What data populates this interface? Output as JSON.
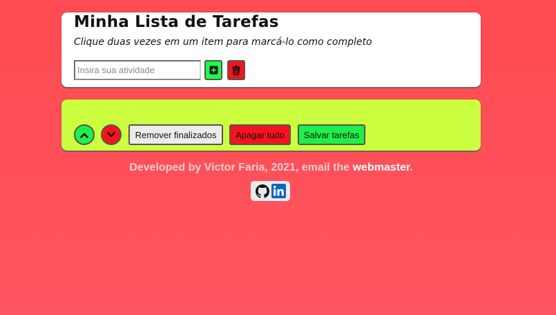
{
  "header": {
    "title": "Minha Lista de Tarefas",
    "subtitle": "Clique duas vezes em um item para marcá-lo como completo"
  },
  "input": {
    "placeholder": "Insira sua atividade",
    "value": ""
  },
  "controls": {
    "add_icon": "plus-square-icon",
    "delete_icon": "trash-icon",
    "move_up_icon": "chevron-up-icon",
    "move_down_icon": "chevron-down-icon",
    "remove_finished_label": "Remover finalizados",
    "clear_all_label": "Apagar tudo",
    "save_label": "Salvar tarefas"
  },
  "task_list": [],
  "footer": {
    "credit_text": "Developed by Victor Faria, 2021, email the ",
    "link_text": "webmaster",
    "suffix": ".",
    "social_icons": [
      "github-icon",
      "linkedin-icon"
    ]
  },
  "colors": {
    "background": "#ff4b52",
    "add_green": "#1cff4a",
    "delete_red": "#f5131d",
    "list_panel": "#ccff3f",
    "linkedin_blue": "#0a66c2"
  }
}
